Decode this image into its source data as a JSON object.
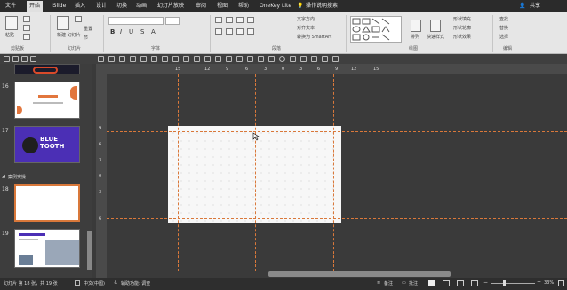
{
  "menu": {
    "file": "文件",
    "home": "开始",
    "islide": "iSlide",
    "insert": "插入",
    "design": "设计",
    "transitions": "切换",
    "animations": "动画",
    "slideshow": "幻灯片放映",
    "review": "审阅",
    "view": "视图",
    "help": "帮助",
    "onekey": "OneKey Lite",
    "tellme": "操作说明搜索",
    "share": "共享"
  },
  "ribbon": {
    "paste": "粘贴",
    "clipboard": "剪贴板",
    "new_slide": "新建\n幻灯片",
    "reset": "重置",
    "section": "节",
    "slides": "幻灯片",
    "font": "字体",
    "paragraph": "段落",
    "drawing": "绘图",
    "editing": "编辑",
    "arrange": "排列",
    "quick_styles": "快速样式",
    "shape_fill": "形状填充",
    "shape_outline": "形状轮廓",
    "shape_effects": "形状效果",
    "text_direction": "文字方向",
    "align_text": "对齐文本",
    "smartart": "转换为 SmartArt",
    "find": "查找",
    "replace": "替换",
    "select": "选择"
  },
  "thumbnails": [
    {
      "num": "16",
      "type": "title"
    },
    {
      "num": "17",
      "type": "bluetooth",
      "text": "BLUE\nTOOTH"
    },
    {
      "num": "18",
      "type": "blank",
      "selected": true
    },
    {
      "num": "19",
      "type": "workspace"
    }
  ],
  "section_label": "案例实操",
  "ruler_top": [
    "15",
    "12",
    "9",
    "6",
    "3",
    "0",
    "3",
    "6",
    "9",
    "12",
    "15"
  ],
  "ruler_left": [
    "9",
    "6",
    "3",
    "0",
    "3",
    "6"
  ],
  "status": {
    "slide_info": "幻灯片 第 18 张，共 19 张",
    "language": "中文(中国)",
    "accessibility": "辅助功能: 调查",
    "notes": "备注",
    "comments": "批注",
    "zoom": "33%"
  },
  "colors": {
    "accent_orange": "#d9783a",
    "ribbon_bg": "#e6e6e6",
    "canvas_bg": "#3a3a3a",
    "blue_thumb": "#4b2fb5"
  }
}
